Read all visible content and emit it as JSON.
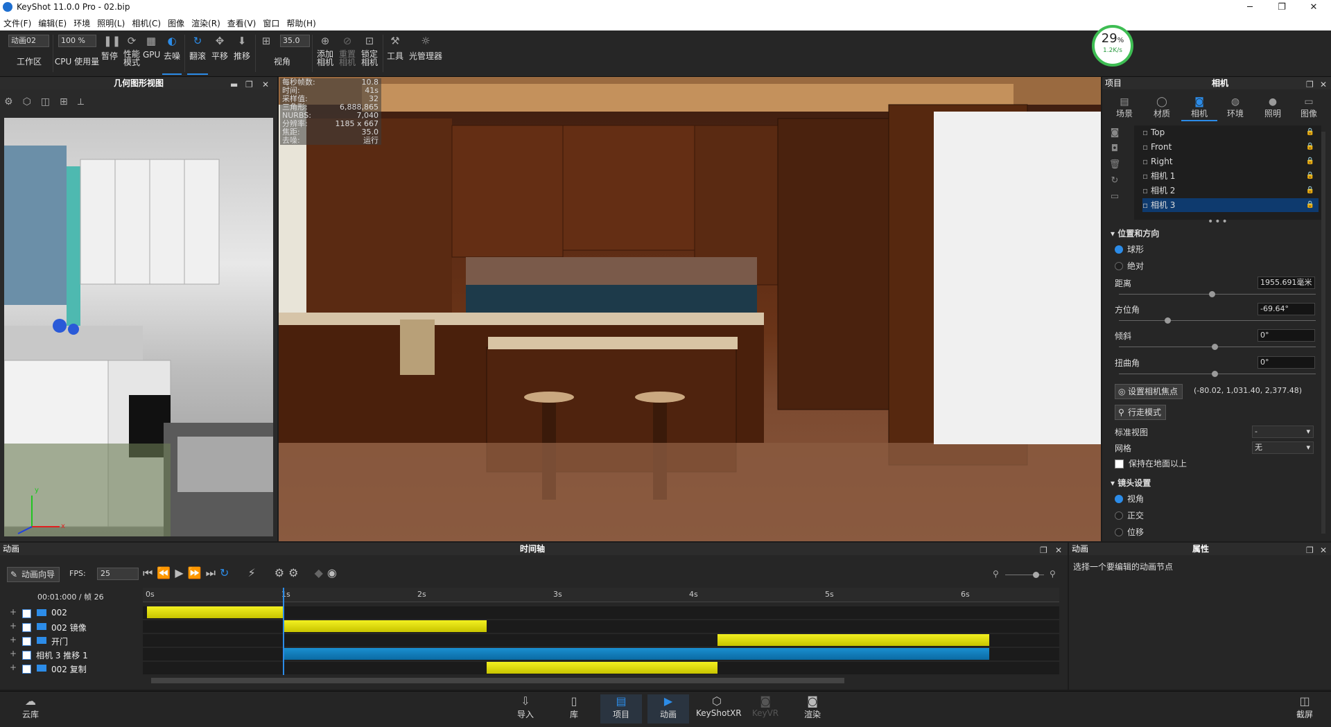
{
  "window": {
    "title": "KeyShot 11.0.0 Pro  - 02.bip",
    "min": "─",
    "max": "❐",
    "close": "✕"
  },
  "menu": [
    "文件(F)",
    "编辑(E)",
    "环境",
    "照明(L)",
    "相机(C)",
    "图像",
    "渲染(R)",
    "查看(V)",
    "窗口",
    "帮助(H)"
  ],
  "toolbar": {
    "workspace_select": "动画02",
    "workspace_label": "工作区",
    "zoom_select": "100 %",
    "cpu_label": "CPU 使用量",
    "pause_label": "暂停",
    "perf_label": "性能\n模式",
    "gpu_label": "GPU",
    "denoise_label": "去噪",
    "tumble_label": "翻滚",
    "pan_label": "平移",
    "dolly_label": "推移",
    "fov_value": "35.0",
    "fov_label": "视角",
    "add_camera_label": "添加\n相机",
    "reset_camera_label": "重置\n相机",
    "lock_camera_label": "锁定\n相机",
    "tools_label": "工具",
    "lightmgr_label": "光管理器"
  },
  "perf": {
    "percent": "29",
    "unit": "%",
    "rate": "1.2K/s",
    "ring_color": "#3ebd53"
  },
  "geometry_view": {
    "title": "几何图形视图",
    "axis_y": "y",
    "axis_x": "x"
  },
  "hud": [
    {
      "k": "每秒帧数:",
      "v": "10.8"
    },
    {
      "k": "时间:",
      "v": "41s"
    },
    {
      "k": "采样值:",
      "v": "32"
    },
    {
      "k": "三角形:",
      "v": "6,888,865"
    },
    {
      "k": "NURBS:",
      "v": "7,040"
    },
    {
      "k": "分辨率:",
      "v": "1185 x 667"
    },
    {
      "k": "焦距:",
      "v": "35.0"
    },
    {
      "k": "去噪:",
      "v": "运行"
    }
  ],
  "right_panel": {
    "project_label": "项目",
    "title": "相机",
    "tabs": [
      "场景",
      "材质",
      "相机",
      "环境",
      "照明",
      "图像"
    ],
    "cameras": [
      "Top",
      "Front",
      "Right",
      "相机 1",
      "相机 2",
      "相机 3"
    ],
    "selected_camera": "相机 3",
    "section_position": "位置和方向",
    "mode_spherical": "球形",
    "mode_absolute": "绝对",
    "distance_label": "距离",
    "distance_value": "1955.691毫米",
    "azimuth_label": "方位角",
    "azimuth_value": "-69.64°",
    "incl_label": "倾斜",
    "incl_value": "0°",
    "twist_label": "扭曲角",
    "twist_value": "0°",
    "focus_btn": "设置相机焦点",
    "focus_coords": "(-80.02, 1,031.40, 2,377.48)",
    "walk_btn": "行走模式",
    "std_view_label": "标准视图",
    "std_view_value": "-",
    "grid_label": "网格",
    "grid_value": "无",
    "keep_ground": "保持在地面以上",
    "section_lens": "镜头设置",
    "lens_fov": "视角",
    "lens_ortho": "正交",
    "lens_shift": "位移"
  },
  "timeline": {
    "panel_label": "动画",
    "title": "时间轴",
    "wizard_btn": "动画向导",
    "fps_label": "FPS:",
    "fps_value": "25",
    "time_readout": "00:01:000 / 帧 26",
    "ticks": [
      "0s",
      "1s",
      "2s",
      "3s",
      "4s",
      "5s",
      "6s"
    ],
    "rows": [
      {
        "name": "002",
        "color": "yellow",
        "start": 0.0,
        "end": 1.0
      },
      {
        "name": "002 镜像",
        "color": "yellow",
        "start": 1.0,
        "end": 2.5
      },
      {
        "name": "开门",
        "color": "yellow",
        "start": 4.2,
        "end": 6.2
      },
      {
        "name": "相机 3 推移 1",
        "color": "blue",
        "start": 1.0,
        "end": 6.2
      },
      {
        "name": "002 复制",
        "color": "yellow",
        "start": 2.5,
        "end": 4.2
      }
    ],
    "duration": 6.2,
    "playhead": 1.0
  },
  "attributes": {
    "panel_label": "动画",
    "title": "属性",
    "hint": "选择一个要编辑的动画节点"
  },
  "bottom_bar": {
    "cloud": "云库",
    "import": "导入",
    "library": "库",
    "project": "项目",
    "animation": "动画",
    "keyshotxr": "KeyShotXR",
    "keyvr": "KeyVR",
    "render": "渲染",
    "screenshot": "截屏"
  },
  "colors": {
    "accent": "#2c8ce8",
    "selection": "#0e3a6e",
    "bar_yellow": "#e8e610",
    "bar_blue": "#1183c2"
  }
}
